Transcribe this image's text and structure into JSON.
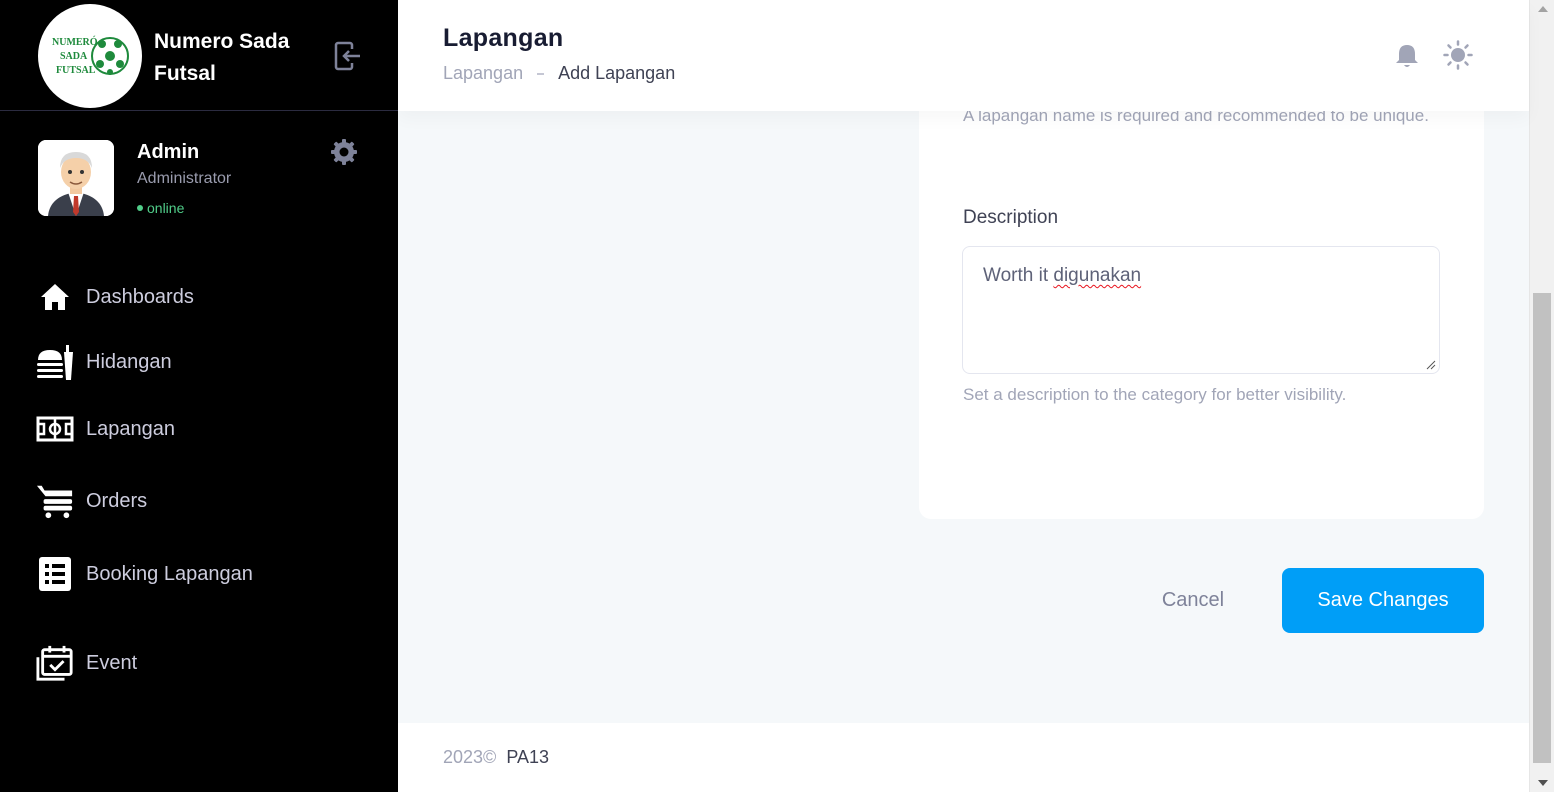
{
  "sidebar": {
    "brand": {
      "line1": "Numero Sada",
      "line2": "Futsal",
      "logo_text": [
        "NUMERÓ",
        "SADA",
        "FUTSAL"
      ]
    },
    "user": {
      "name": "Admin",
      "role": "Administrator",
      "status": "online"
    },
    "nav": [
      {
        "label": "Dashboards",
        "icon": "home-icon"
      },
      {
        "label": "Hidangan",
        "icon": "food-icon"
      },
      {
        "label": "Lapangan",
        "icon": "field-icon"
      },
      {
        "label": "Orders",
        "icon": "cart-icon"
      },
      {
        "label": "Booking Lapangan",
        "icon": "list-icon"
      },
      {
        "label": "Event",
        "icon": "calendar-check-icon"
      }
    ]
  },
  "header": {
    "title": "Lapangan",
    "breadcrumb": {
      "parent": "Lapangan",
      "current": "Add Lapangan"
    }
  },
  "form": {
    "name_hint": "A lapangan name is required and recommended to be unique.",
    "description": {
      "label": "Description",
      "value_plain": "Worth it ",
      "value_misspelled": "digunakan",
      "hint": "Set a description to the category for better visibility."
    }
  },
  "actions": {
    "cancel": "Cancel",
    "save": "Save Changes"
  },
  "footer": {
    "year": "2023©",
    "company": "PA13"
  },
  "colors": {
    "primary": "#009ef7",
    "sidebar_bg": "#000000",
    "online": "#50cd89"
  }
}
